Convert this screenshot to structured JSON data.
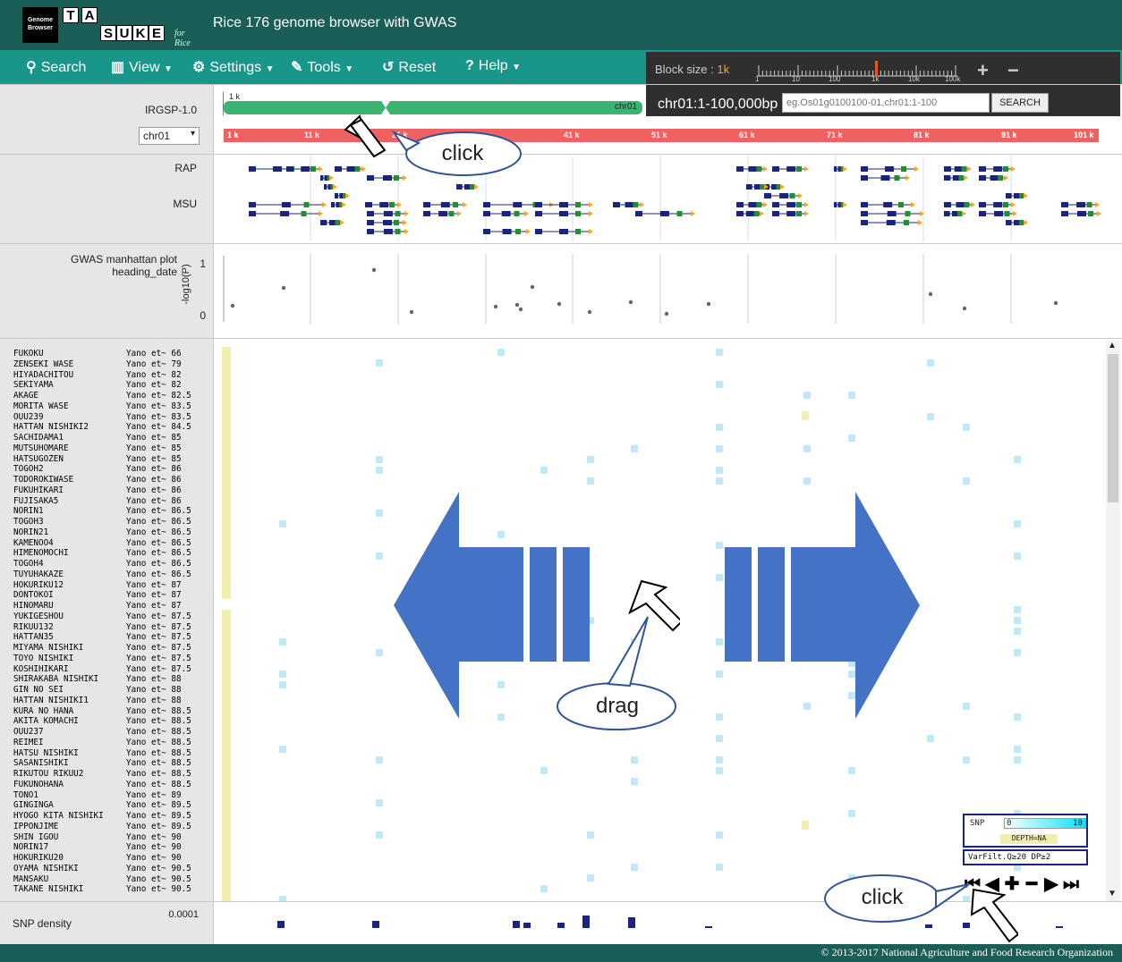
{
  "app": {
    "logo_line1": "Genome",
    "logo_line2": "Browser",
    "logo_letters": [
      "T",
      "A",
      "S",
      "U",
      "K",
      "E"
    ],
    "logo_suffix": "for Rice",
    "title": "Rice 176 genome browser with GWAS"
  },
  "menu": {
    "search": "Search",
    "view": "View",
    "settings": "Settings",
    "tools": "Tools",
    "reset": "Reset",
    "help": "Help"
  },
  "block": {
    "label": "Block size : ",
    "value": "1k",
    "ticks": [
      "1",
      "10",
      "100",
      "1k",
      "10k",
      "100k"
    ],
    "plus": "+",
    "minus": "−"
  },
  "location": {
    "current": "chr01:1-100,000bp",
    "search_placeholder": "eg.Os01g0100100-01,chr01:1-100",
    "search_button": "SEARCH"
  },
  "reference": {
    "name": "IRGSP-1.0",
    "chromosome": "chr01",
    "chr_label": "chr01",
    "overview_label": "1 k",
    "coord_ticks": [
      "1 k",
      "11 k",
      "21 k",
      "41 k",
      "51 k",
      "61 k",
      "71 k",
      "81 k",
      "91 k",
      "101 k"
    ]
  },
  "tracks": {
    "rap": "RAP",
    "msu": "MSU",
    "gwas_title": "GWAS manhattan plot",
    "gwas_sub": "heading_date",
    "yaxis": "-log10(P)",
    "y_top": "1",
    "y_bottom": "0",
    "snp_density": "SNP density",
    "snp_density_val": "0.0001"
  },
  "varieties": [
    [
      "FUKOKU",
      "Yano et~ 66"
    ],
    [
      "ZENSEKI WASE",
      "Yano et~ 79"
    ],
    [
      "HIYADACHITOU",
      "Yano et~ 82"
    ],
    [
      "SEKIYAMA",
      "Yano et~ 82"
    ],
    [
      "AKAGE",
      "Yano et~ 82.5"
    ],
    [
      "MORITA WASE",
      "Yano et~ 83.5"
    ],
    [
      "OUU239",
      "Yano et~ 83.5"
    ],
    [
      "HATTAN NISHIKI2",
      "Yano et~ 84.5"
    ],
    [
      "SACHIDAMA1",
      "Yano et~ 85"
    ],
    [
      "MUTSUHOMARE",
      "Yano et~ 85"
    ],
    [
      "HATSUGOZEN",
      "Yano et~ 85"
    ],
    [
      "TOGOH2",
      "Yano et~ 86"
    ],
    [
      "TODOROKIWASE",
      "Yano et~ 86"
    ],
    [
      "FUKUHIKARI",
      "Yano et~ 86"
    ],
    [
      "FUJISAKA5",
      "Yano et~ 86"
    ],
    [
      "NORIN1",
      "Yano et~ 86.5"
    ],
    [
      "TOGOH3",
      "Yano et~ 86.5"
    ],
    [
      "NORIN21",
      "Yano et~ 86.5"
    ],
    [
      "KAMENOO4",
      "Yano et~ 86.5"
    ],
    [
      "HIMENOMOCHI",
      "Yano et~ 86.5"
    ],
    [
      "TOGOH4",
      "Yano et~ 86.5"
    ],
    [
      "TUYUHAKAZE",
      "Yano et~ 86.5"
    ],
    [
      "HOKURIKU12",
      "Yano et~ 87"
    ],
    [
      "DONTOKOI",
      "Yano et~ 87"
    ],
    [
      "HINOMARU",
      "Yano et~ 87"
    ],
    [
      "YUKIGESHOU",
      "Yano et~ 87.5"
    ],
    [
      "RIKUU132",
      "Yano et~ 87.5"
    ],
    [
      "HATTAN35",
      "Yano et~ 87.5"
    ],
    [
      "MIYAMA NISHIKI",
      "Yano et~ 87.5"
    ],
    [
      "TOYO NISHIKI",
      "Yano et~ 87.5"
    ],
    [
      "KOSHIHIKARI",
      "Yano et~ 87.5"
    ],
    [
      "SHIRAKABA NISHIKI",
      "Yano et~ 88"
    ],
    [
      "GIN NO SEI",
      "Yano et~ 88"
    ],
    [
      "HATTAN NISHIKI1",
      "Yano et~ 88"
    ],
    [
      "KURA NO HANA",
      "Yano et~ 88.5"
    ],
    [
      "AKITA KOMACHI",
      "Yano et~ 88.5"
    ],
    [
      "OUU237",
      "Yano et~ 88.5"
    ],
    [
      "REIMEI",
      "Yano et~ 88.5"
    ],
    [
      "HATSU NISHIKI",
      "Yano et~ 88.5"
    ],
    [
      "SASANISHIKI",
      "Yano et~ 88.5"
    ],
    [
      "RIKUTOU RIKUU2",
      "Yano et~ 88.5"
    ],
    [
      "FUKUNOHANA",
      "Yano et~ 88.5"
    ],
    [
      "TONO1",
      "Yano et~ 89"
    ],
    [
      "GINGINGA",
      "Yano et~ 89.5"
    ],
    [
      "HYOGO KITA NISHIKI",
      "Yano et~ 89.5"
    ],
    [
      "IPPONJIME",
      "Yano et~ 89.5"
    ],
    [
      "SHIN IGOU",
      "Yano et~ 90"
    ],
    [
      "NORIN17",
      "Yano et~ 90"
    ],
    [
      "HOKURIKU20",
      "Yano et~ 90"
    ],
    [
      "OYAMA NISHIKI",
      "Yano et~ 90.5"
    ],
    [
      "MANSAKU",
      "Yano et~ 90.5"
    ],
    [
      "TAKANE NISHIKI",
      "Yano et~ 90.5"
    ]
  ],
  "legend": {
    "snp": "SNP",
    "min": "0",
    "max": "10",
    "depth": "DEPTH=NA",
    "filter": "VarFilt.Q≥20  DP≥2"
  },
  "callouts": {
    "click_top": "click",
    "drag": "drag",
    "click_bottom": "click"
  },
  "footer": "© 2013-2017 National Agriculture and Food Research Organization",
  "colors": {
    "topbar": "#1b5e57",
    "menubar": "#18968a",
    "chr_green": "#3cb371",
    "coord_red": "#f06262",
    "arrow_blue": "#4472c4",
    "gene_navy": "#1a237e",
    "snp_cyan": "#bfe9f7"
  }
}
